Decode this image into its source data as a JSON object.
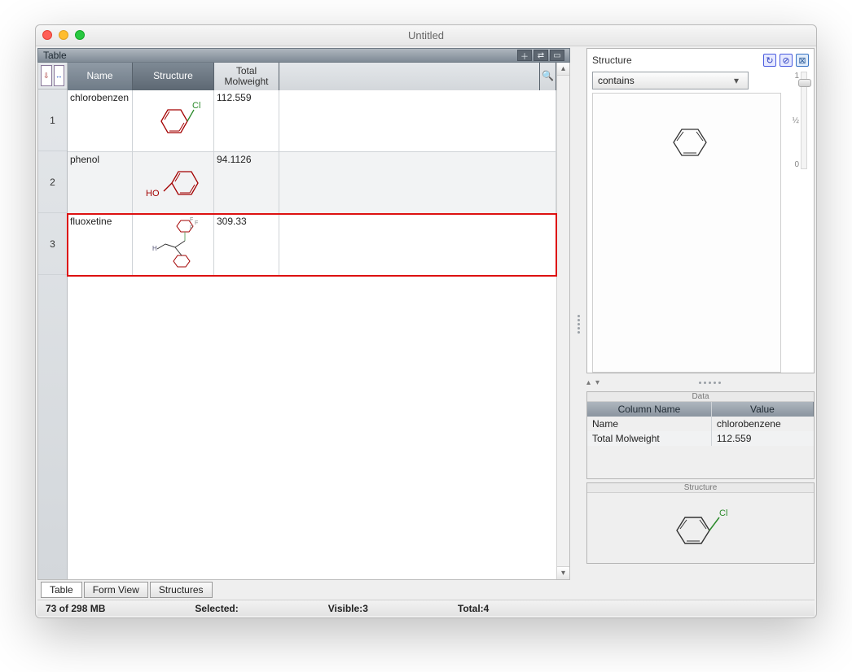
{
  "window": {
    "title": "Untitled"
  },
  "table_panel": {
    "title": "Table",
    "columns": {
      "name": "Name",
      "structure": "Structure",
      "molweight": "Total\nMolweight"
    },
    "rows": [
      {
        "num": "1",
        "name": "chlorobenzen",
        "molweight": "112.559"
      },
      {
        "num": "2",
        "name": "phenol",
        "molweight": "94.1126"
      },
      {
        "num": "3",
        "name": "fluoxetine",
        "molweight": "309.33"
      }
    ]
  },
  "view_tabs": {
    "table": "Table",
    "form": "Form View",
    "structures": "Structures"
  },
  "structure_search": {
    "title": "Structure",
    "mode": "contains",
    "slider": {
      "top": "1",
      "mid": "½",
      "bot": "0"
    }
  },
  "data_panel": {
    "title": "Data",
    "columns": {
      "name": "Column Name",
      "value": "Value"
    },
    "rows": [
      {
        "name": "Name",
        "value": "chlorobenzene"
      },
      {
        "name": "Total Molweight",
        "value": "112.559"
      }
    ]
  },
  "structure_preview": {
    "title": "Structure",
    "label": "Cl"
  },
  "statusbar": {
    "memory": "73 of 298 MB",
    "selected_label": "Selected:",
    "visible_label": "Visible:",
    "visible_value": "3",
    "total_label": "Total:",
    "total_value": "4"
  },
  "structures": {
    "row0_label": "Cl",
    "row1_label": "HO"
  }
}
